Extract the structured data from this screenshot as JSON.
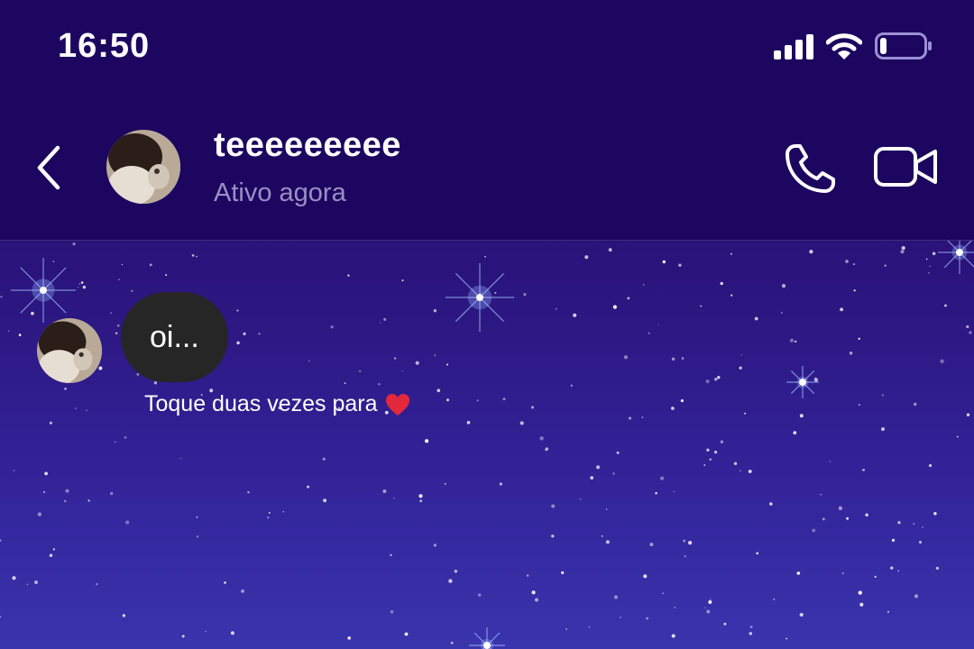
{
  "status_bar": {
    "time": "16:50",
    "icons": [
      "cellular-signal-icon",
      "wifi-icon",
      "battery-icon"
    ]
  },
  "header": {
    "contact_name": "teeeeeeeee",
    "contact_status": "Ativo agora",
    "icons": [
      "back-chevron-icon",
      "phone-icon",
      "video-camera-icon"
    ]
  },
  "messages": [
    {
      "sender": "other",
      "text": "oi..."
    }
  ],
  "hint": {
    "text": "Toque duas vezes para",
    "icon": "heart-icon"
  },
  "colors": {
    "header_bg": "#1c0660",
    "bubble_bg": "#262626",
    "status_text": "#9b8fc4",
    "heart": "#e3283c"
  }
}
